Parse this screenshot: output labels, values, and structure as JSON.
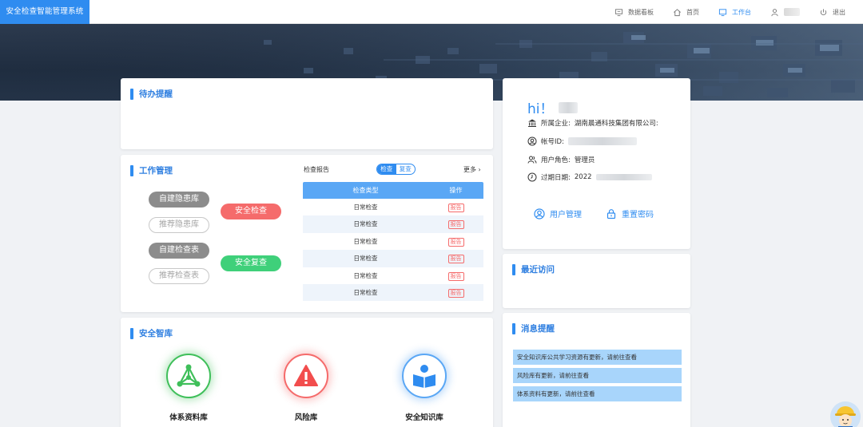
{
  "app": {
    "title": "安全检查智能管理系统"
  },
  "topnav": {
    "dashboard": "数据看板",
    "home": "首页",
    "workbench": "工作台",
    "logout": "退出"
  },
  "todo": {
    "title": "待办提醒"
  },
  "work": {
    "title": "工作管理",
    "buttons": {
      "self_hazard": "自建隐患库",
      "recommend_hazard": "推荐隐患库",
      "self_checklist": "自建检查表",
      "recommend_checklist": "推荐检查表",
      "safety_check": "安全检查",
      "safety_recheck": "安全复查"
    },
    "report_label": "检查报告",
    "toggle": {
      "check": "检查",
      "recheck": "复查"
    },
    "more": "更多 ›",
    "table": {
      "columns": [
        "检查类型",
        "操作"
      ],
      "rows": [
        {
          "type": "日常检查",
          "action": "报告"
        },
        {
          "type": "日常检查",
          "action": "报告"
        },
        {
          "type": "日常检查",
          "action": "报告"
        },
        {
          "type": "日常检查",
          "action": "报告"
        },
        {
          "type": "日常检查",
          "action": "报告"
        },
        {
          "type": "日常检查",
          "action": "报告"
        }
      ]
    }
  },
  "library": {
    "title": "安全智库",
    "items": [
      {
        "label": "体系资料库",
        "icon": "network-icon",
        "color": "#3fbf5a"
      },
      {
        "label": "风险库",
        "icon": "warning-icon",
        "color": "#f24d4d"
      },
      {
        "label": "安全知识库",
        "icon": "reader-icon",
        "color": "#2f8cf0"
      }
    ]
  },
  "profile": {
    "greeting": "hi！",
    "company_label": "所属企业:",
    "company": "湖南晨通科技集团有限公司:",
    "account_label": "帐号ID:",
    "role_label": "用户角色:",
    "role": "管理员",
    "expire_label": "过期日期:",
    "expire_prefix": "2022",
    "user_manage": "用户管理",
    "reset_password": "重置密码"
  },
  "recent": {
    "title": "最近访问"
  },
  "messages": {
    "title": "消息提醒",
    "items": [
      "安全知识库公共学习资源有更新，请前往查看",
      "风险库有更新，请前往查看",
      "体系资料有更新，请前往查看"
    ]
  },
  "colors": {
    "primary": "#2f8cf0",
    "danger": "#f56b6b",
    "success": "#3fd07a"
  }
}
